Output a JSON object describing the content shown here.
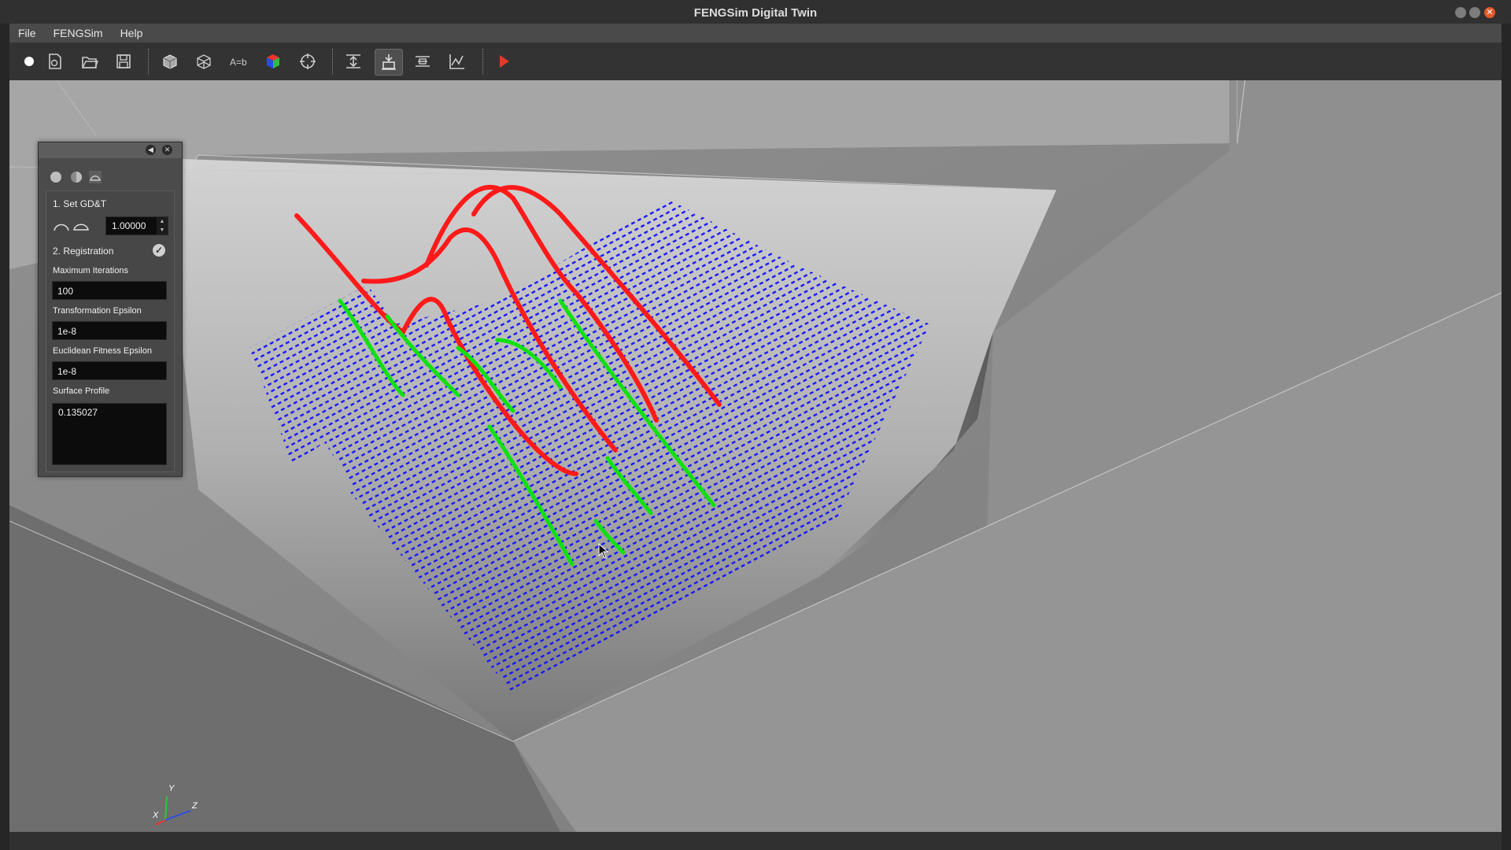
{
  "window": {
    "title": "FENGSim Digital Twin"
  },
  "menubar": {
    "items": [
      "File",
      "FENGSim",
      "Help"
    ]
  },
  "toolbar": {
    "buttons": [
      "record-icon",
      "new-document-icon",
      "open-folder-icon",
      "save-icon",
      "solid-box-icon",
      "wireframe-icon",
      "axis-labels-icon",
      "color-cube-icon",
      "target-icon",
      "align-icon",
      "measure-icon",
      "transform-icon",
      "chart-icon",
      "run-arrow-icon"
    ],
    "active": "measure-icon"
  },
  "panel": {
    "section1": "1. Set GD&T",
    "gdt_value": "1.00000",
    "section2": "2. Registration",
    "max_iter_label": "Maximum Iterations",
    "max_iter_value": "100",
    "trans_eps_label": "Transformation Epsilon",
    "trans_eps_value": "1e-8",
    "fit_eps_label": "Euclidean Fitness Epsilon",
    "fit_eps_value": "1e-8",
    "surface_label": "Surface Profile",
    "surface_value": "0.135027"
  },
  "axes": {
    "y": "Y",
    "x": "X",
    "z": "Z"
  },
  "colors": {
    "point_cloud": "#1a1aff",
    "upper_curves": "#ff1a1a",
    "lower_curves": "#10e010"
  }
}
